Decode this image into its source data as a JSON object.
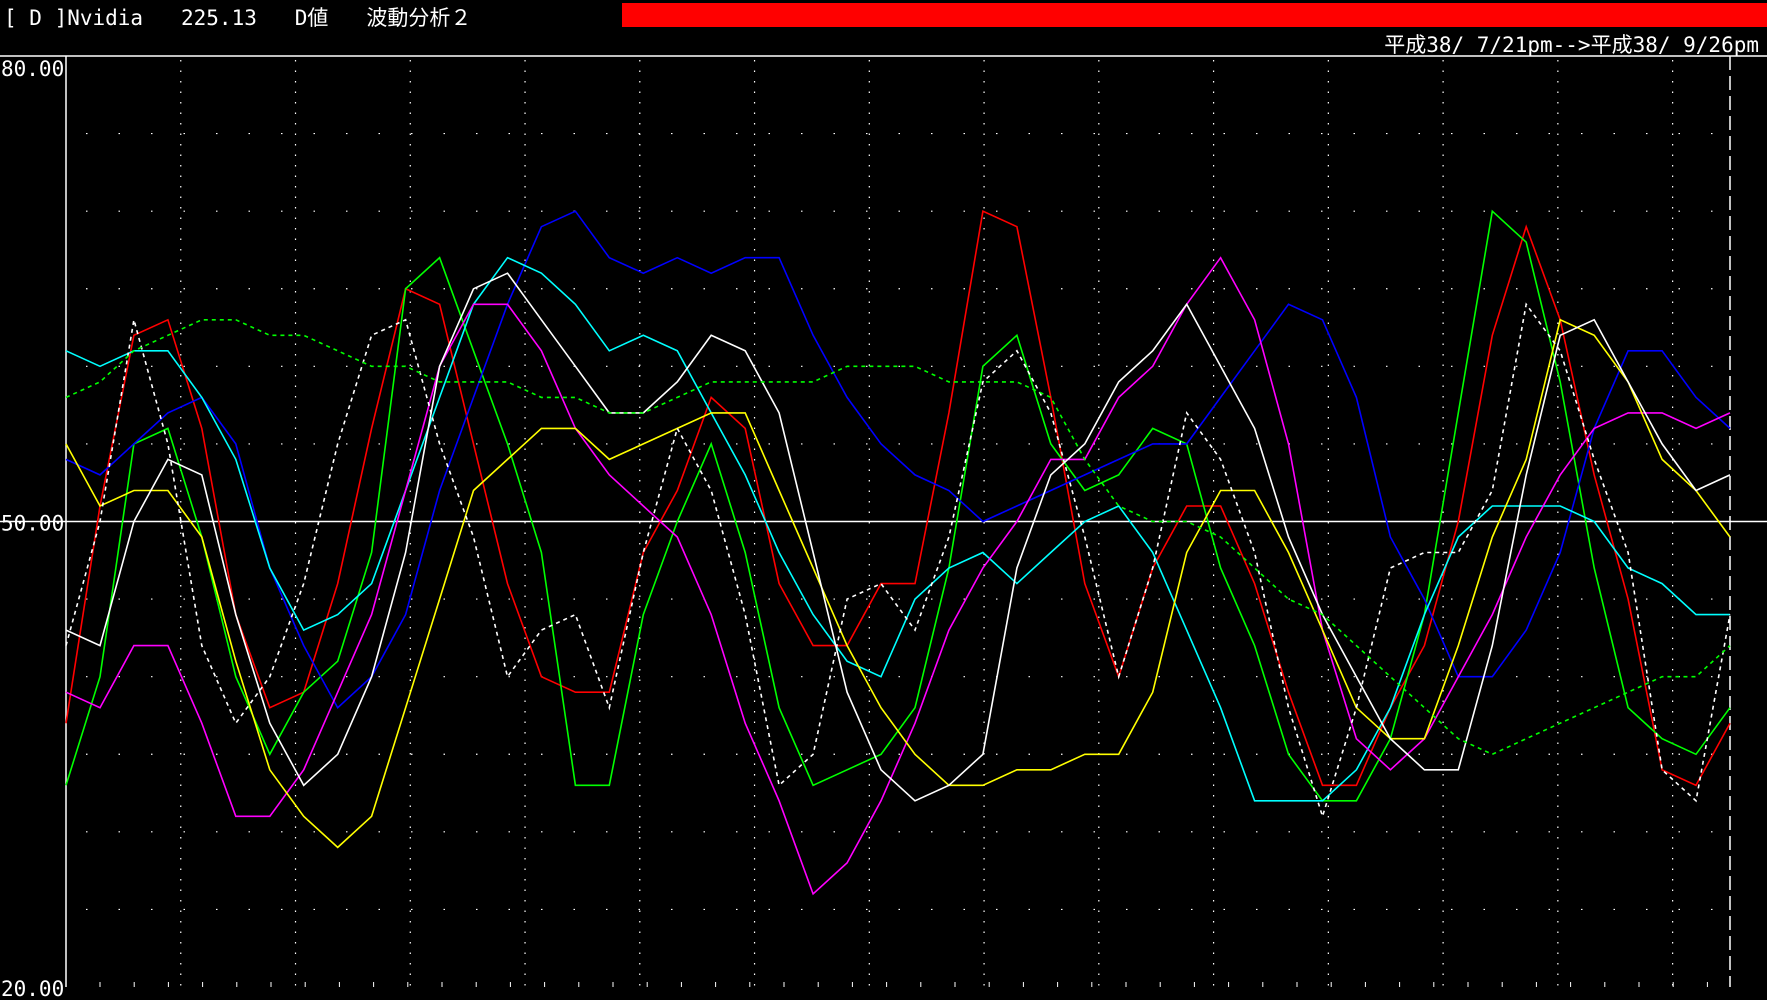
{
  "header": {
    "title": "[ D ]Nvidia   225.13   D値   波動分析２",
    "date_range": "平成38/ 7/21pm-->平成38/ 9/26pm",
    "bar_color": "#ff0000"
  },
  "chart_data": {
    "type": "line",
    "ylim": [
      20,
      80
    ],
    "y_ticks": [
      "80.00",
      "50.00",
      "20.00"
    ],
    "reference_line": 50,
    "x": [
      0,
      1,
      2,
      3,
      4,
      5,
      6,
      7,
      8,
      9,
      10,
      11,
      12,
      13,
      14,
      15,
      16,
      17,
      18,
      19,
      20,
      21,
      22,
      23,
      24,
      25,
      26,
      27,
      28,
      29,
      30,
      31,
      32,
      33,
      34,
      35,
      36,
      37,
      38,
      39,
      40,
      41,
      42,
      43,
      44,
      45,
      46,
      47,
      48,
      49
    ],
    "colors": {
      "background": "#000000",
      "axis": "#ffffff",
      "grid": "#ffffff"
    },
    "series": [
      {
        "color": "#ff0000",
        "style": "solid",
        "values": [
          37,
          51,
          62,
          63,
          56,
          44,
          38,
          39,
          46,
          56,
          65,
          64,
          55,
          46,
          40,
          39,
          39,
          48,
          52,
          58,
          56,
          46,
          42,
          42,
          46,
          46,
          57,
          70,
          69,
          58,
          46,
          40,
          47,
          51,
          51,
          46,
          39,
          33,
          33,
          38,
          42,
          50,
          62,
          69,
          63,
          53,
          45,
          34,
          33,
          37
        ]
      },
      {
        "color": "#00ff00",
        "style": "solid",
        "values": [
          33,
          40,
          55,
          56,
          49,
          40,
          35,
          39,
          41,
          48,
          65,
          67,
          61,
          55,
          48,
          33,
          33,
          44,
          50,
          55,
          48,
          38,
          33,
          34,
          35,
          38,
          47,
          60,
          62,
          55,
          52,
          53,
          56,
          55,
          47,
          42,
          35,
          32,
          32,
          36,
          44,
          57,
          70,
          68,
          59,
          47,
          38,
          36,
          35,
          38
        ]
      },
      {
        "color": "#0000ff",
        "style": "solid",
        "values": [
          54,
          53,
          55,
          57,
          58,
          55,
          47,
          42,
          38,
          40,
          44,
          52,
          58,
          64,
          69,
          70,
          67,
          66,
          67,
          66,
          67,
          67,
          62,
          58,
          55,
          53,
          52,
          50,
          51,
          52,
          53,
          54,
          55,
          55,
          58,
          61,
          64,
          63,
          58,
          49,
          45,
          40,
          40,
          43,
          48,
          56,
          61,
          61,
          58,
          56
        ]
      },
      {
        "color": "#00ffff",
        "style": "solid",
        "values": [
          61,
          60,
          61,
          61,
          58,
          54,
          47,
          43,
          44,
          46,
          52,
          58,
          64,
          67,
          66,
          64,
          61,
          62,
          61,
          57,
          53,
          48,
          44,
          41,
          40,
          45,
          47,
          48,
          46,
          48,
          50,
          51,
          48,
          43,
          38,
          32,
          32,
          32,
          34,
          38,
          44,
          49,
          51,
          51,
          51,
          50,
          47,
          46,
          44,
          44
        ]
      },
      {
        "color": "#ff00ff",
        "style": "solid",
        "values": [
          39,
          38,
          42,
          42,
          37,
          31,
          31,
          34,
          39,
          44,
          52,
          60,
          64,
          64,
          61,
          56,
          53,
          51,
          49,
          44,
          37,
          32,
          26,
          28,
          32,
          37,
          43,
          47,
          50,
          54,
          54,
          58,
          60,
          64,
          67,
          63,
          55,
          43,
          36,
          34,
          36,
          40,
          44,
          49,
          53,
          56,
          57,
          57,
          56,
          57
        ]
      },
      {
        "color": "#ffff00",
        "style": "solid",
        "values": [
          55,
          51,
          52,
          52,
          49,
          41,
          34,
          31,
          29,
          31,
          38,
          45,
          52,
          54,
          56,
          56,
          54,
          55,
          56,
          57,
          57,
          52,
          47,
          42,
          38,
          35,
          33,
          33,
          34,
          34,
          35,
          35,
          39,
          48,
          52,
          52,
          48,
          43,
          38,
          36,
          36,
          42,
          49,
          54,
          63,
          62,
          59,
          54,
          52,
          49
        ]
      },
      {
        "color": "#ffffff",
        "style": "solid",
        "values": [
          43,
          42,
          50,
          54,
          53,
          44,
          37,
          33,
          35,
          40,
          48,
          60,
          65,
          66,
          63,
          60,
          57,
          57,
          59,
          62,
          61,
          57,
          48,
          39,
          34,
          32,
          33,
          35,
          47,
          53,
          55,
          59,
          61,
          64,
          60,
          56,
          49,
          44,
          40,
          36,
          34,
          34,
          42,
          53,
          62,
          63,
          59,
          55,
          52,
          53
        ]
      },
      {
        "color": "#ffffff",
        "style": "dotted",
        "values": [
          42,
          50,
          63,
          55,
          42,
          37,
          40,
          46,
          55,
          62,
          63,
          55,
          49,
          40,
          43,
          44,
          38,
          48,
          56,
          52,
          44,
          33,
          35,
          45,
          46,
          43,
          49,
          59,
          61,
          57,
          49,
          40,
          47,
          57,
          54,
          48,
          38,
          31,
          38,
          47,
          48,
          48,
          52,
          64,
          61,
          54,
          48,
          34,
          32,
          44
        ]
      },
      {
        "color": "#00ff00",
        "style": "dotted",
        "values": [
          58,
          59,
          61,
          62,
          63,
          63,
          62,
          62,
          61,
          60,
          60,
          59,
          59,
          59,
          58,
          58,
          57,
          57,
          58,
          59,
          59,
          59,
          59,
          60,
          60,
          60,
          59,
          59,
          59,
          58,
          54,
          51,
          50,
          50,
          49,
          47,
          45,
          44,
          42,
          40,
          38,
          36,
          35,
          36,
          37,
          38,
          39,
          40,
          40,
          42
        ]
      }
    ]
  }
}
